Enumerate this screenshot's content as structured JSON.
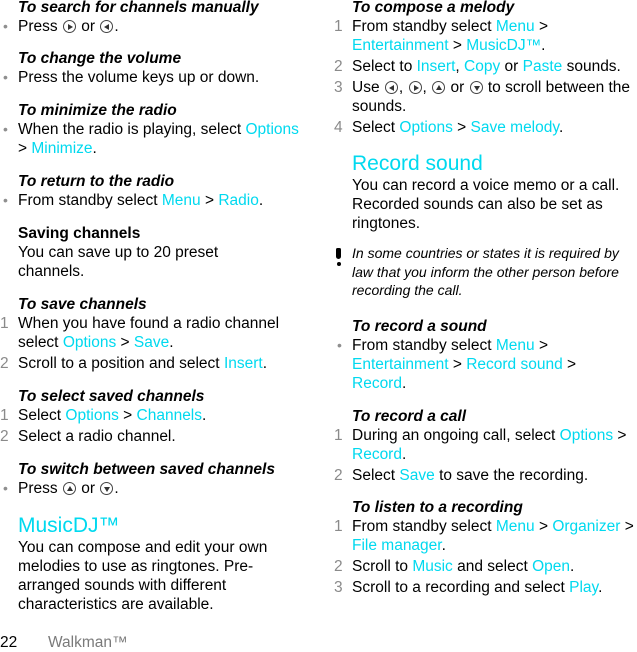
{
  "left": {
    "search_manually": {
      "heading": "To search for channels manually",
      "bullet": {
        "pre": "Press",
        "mid": "or",
        "post": ".",
        "icons": [
          "nav-right-icon",
          "nav-left-icon"
        ]
      }
    },
    "change_volume": {
      "heading": "To change the volume",
      "bullet": "Press the volume keys up or down."
    },
    "minimize_radio": {
      "heading": "To minimize the radio",
      "bullet": {
        "text": "When the radio is playing, select",
        "links": [
          "Options",
          "Minimize"
        ]
      }
    },
    "return_radio": {
      "heading": "To return to the radio",
      "bullet": {
        "text": "From standby select",
        "links": [
          "Menu",
          "Radio"
        ]
      }
    },
    "saving_channels": {
      "heading": "Saving channels",
      "body": "You can save up to 20 preset channels."
    },
    "save_channels": {
      "heading": "To save channels",
      "steps": [
        {
          "num": "1",
          "text": "When you have found a radio channel select",
          "links": [
            "Options",
            "Save"
          ]
        },
        {
          "num": "2",
          "text": "Scroll to a position and select",
          "links": [
            "Insert"
          ]
        }
      ]
    },
    "select_saved": {
      "heading": "To select saved channels",
      "steps": [
        {
          "num": "1",
          "text": "Select",
          "links": [
            "Options",
            "Channels"
          ]
        },
        {
          "num": "2",
          "text": "Select a radio channel."
        }
      ]
    },
    "switch_saved": {
      "heading": "To switch between saved channels",
      "bullet": {
        "pre": "Press",
        "mid": "or",
        "post": ".",
        "icons": [
          "nav-up-icon",
          "nav-down-icon"
        ]
      }
    },
    "musicdj": {
      "heading": "MusicDJ™",
      "body": "You can compose and edit your own melodies to use as ringtones. Pre-arranged sounds with different characteristics are available."
    }
  },
  "right": {
    "compose": {
      "heading": "To compose a melody",
      "steps": [
        {
          "num": "1",
          "text": "From standby select",
          "links": [
            "Menu",
            "Entertainment",
            "MusicDJ™"
          ]
        },
        {
          "num": "2",
          "pre": "Select to",
          "links": [
            "Insert",
            "Copy",
            "Paste"
          ],
          "sep": ",",
          "or": "or",
          "post": "sounds."
        },
        {
          "num": "3",
          "pre": "Use",
          "or": "or",
          "post": "to scroll between the sounds.",
          "icons": [
            "nav-left-icon",
            "nav-right-icon",
            "nav-up-icon",
            "nav-down-icon"
          ]
        },
        {
          "num": "4",
          "text": "Select",
          "links": [
            "Options",
            "Save melody"
          ]
        }
      ]
    },
    "record_sound": {
      "heading": "Record sound",
      "body": "You can record a voice memo or a call. Recorded sounds can also be set as ringtones.",
      "note": "In some countries or states it is required by law that you inform the other person before recording the call."
    },
    "record_a_sound": {
      "heading": "To record a sound",
      "bullet": {
        "text": "From standby select",
        "links": [
          "Menu",
          "Entertainment",
          "Record sound",
          "Record"
        ]
      }
    },
    "record_call": {
      "heading": "To record a call",
      "steps": [
        {
          "num": "1",
          "text": "During an ongoing call, select",
          "links": [
            "Options",
            "Record"
          ]
        },
        {
          "num": "2",
          "pre": "Select",
          "links": [
            "Save"
          ],
          "post": "to save the recording."
        }
      ]
    },
    "listen": {
      "heading": "To listen to a recording",
      "steps": [
        {
          "num": "1",
          "text": "From standby select",
          "links": [
            "Menu",
            "Organizer",
            "File manager"
          ]
        },
        {
          "num": "2",
          "pre": "Scroll to",
          "links": [
            "Music",
            "Open"
          ],
          "mid": "and select"
        },
        {
          "num": "3",
          "text": "Scroll to a recording and select",
          "links": [
            "Play"
          ]
        }
      ]
    }
  },
  "footer": {
    "page_number": "22",
    "chapter": "Walkman™"
  },
  "symbols": {
    "sep": ">",
    "period": ".",
    "comma": ","
  },
  "colors": {
    "link": "#00d9ef",
    "marker": "#8a8a8a",
    "footer_title": "#7a7a7a"
  }
}
